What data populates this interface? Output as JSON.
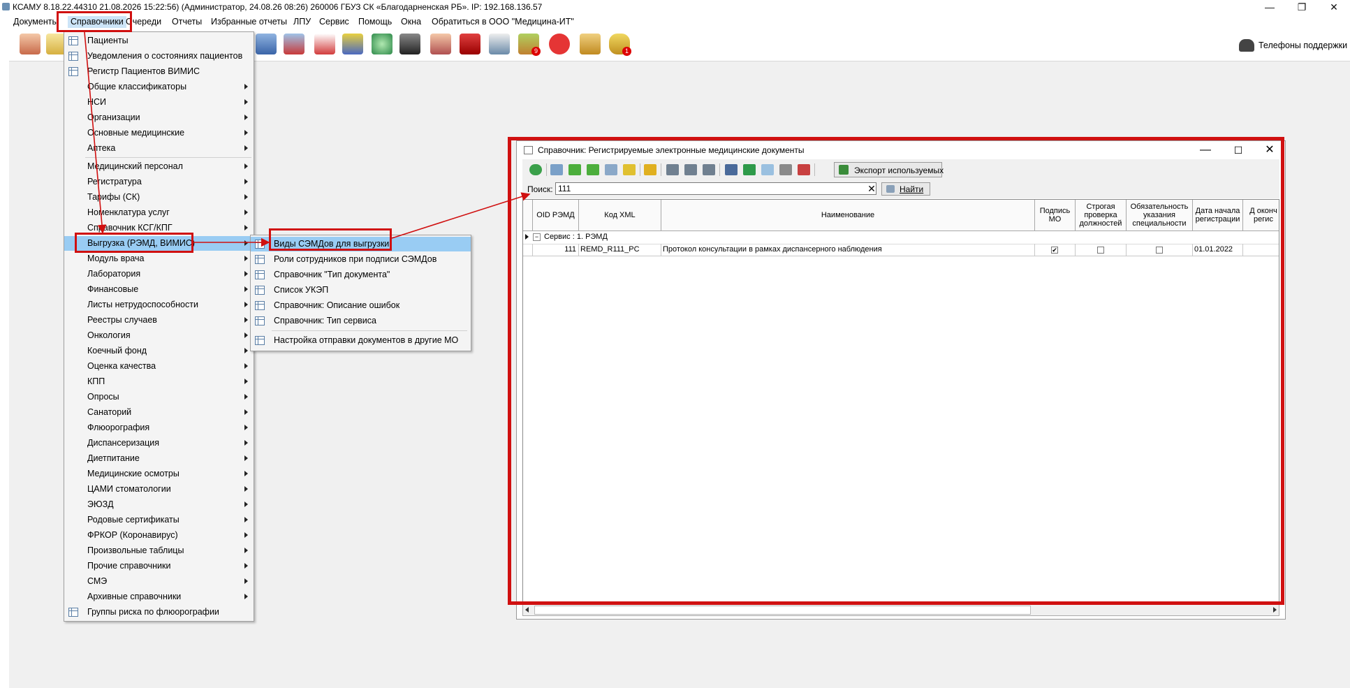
{
  "app": {
    "title": "КСАМУ 8.18.22.44310 21.08.2026 15:22:56) (Администратор, 24.08.26 08:26)  260006 ГБУЗ СК «Благодарненская РБ». IP: 192.168.136.57",
    "window_controls": {
      "minimize": "—",
      "maximize": "❐",
      "close": "✕"
    }
  },
  "menubar": [
    "Документы",
    "Справочники",
    "Очереди",
    "Отчеты",
    "Избранные отчеты",
    "ЛПУ",
    "Сервис",
    "Помощь",
    "Окна",
    "Обратиться в ООО \"Медицина-ИТ\""
  ],
  "support": {
    "label": "Телефоны поддержки",
    "icon": "phone-icon"
  },
  "toolbar_badges": {
    "badge1": "9",
    "badge2": "1"
  },
  "menu_main": {
    "items": [
      {
        "label": "Пациенты",
        "submenu": false,
        "icon": "patient-icon"
      },
      {
        "label": "Уведомления о состояниях пациентов",
        "submenu": false,
        "icon": "table-icon"
      },
      {
        "label": "Регистр Пациентов ВИМИС",
        "submenu": false,
        "icon": "grid-icon"
      },
      {
        "label": "Общие классификаторы",
        "submenu": true
      },
      {
        "label": "НСИ",
        "submenu": true
      },
      {
        "label": "Организации",
        "submenu": true
      },
      {
        "label": "Основные медицинские",
        "submenu": true
      },
      {
        "label": "Аптека",
        "submenu": true
      },
      {
        "label": "Медицинский персонал",
        "submenu": true
      },
      {
        "label": "Регистратура",
        "submenu": true
      },
      {
        "label": "Тарифы (СК)",
        "submenu": true
      },
      {
        "label": "Номенклатура услуг",
        "submenu": true
      },
      {
        "label": "Справочник КСГ/КПГ",
        "submenu": true
      },
      {
        "label": "Выгрузка (РЭМД, ВИМИС)",
        "submenu": true,
        "highlighted": true
      },
      {
        "label": "Модуль врача",
        "submenu": true
      },
      {
        "label": "Лаборатория",
        "submenu": true
      },
      {
        "label": "Финансовые",
        "submenu": true
      },
      {
        "label": "Листы нетрудоспособности",
        "submenu": true
      },
      {
        "label": "Реестры случаев",
        "submenu": true
      },
      {
        "label": "Онкология",
        "submenu": true
      },
      {
        "label": "Коечный фонд",
        "submenu": true
      },
      {
        "label": "Оценка качества",
        "submenu": true
      },
      {
        "label": "КПП",
        "submenu": true
      },
      {
        "label": "Опросы",
        "submenu": true
      },
      {
        "label": "Санаторий",
        "submenu": true
      },
      {
        "label": "Флюорография",
        "submenu": true
      },
      {
        "label": "Диспансеризация",
        "submenu": true
      },
      {
        "label": "Диетпитание",
        "submenu": true
      },
      {
        "label": "Медицинские осмотры",
        "submenu": true
      },
      {
        "label": "ЦАМИ стоматологии",
        "submenu": true
      },
      {
        "label": "ЭЮЗД",
        "submenu": true
      },
      {
        "label": "Родовые сертификаты",
        "submenu": true
      },
      {
        "label": "ФРКОР (Коронавирус)",
        "submenu": true
      },
      {
        "label": "Произвольные таблицы",
        "submenu": true
      },
      {
        "label": "Прочие справочники",
        "submenu": true
      },
      {
        "label": "СМЭ",
        "submenu": true
      },
      {
        "label": "Архивные справочники",
        "submenu": true
      },
      {
        "label": "Группы риска по флюорографии",
        "submenu": false,
        "icon": "table-icon"
      }
    ]
  },
  "menu_sub": {
    "items": [
      {
        "label": "Виды СЭМДов для выгрузки",
        "highlighted": true
      },
      {
        "label": "Роли сотрудников при подписи СЭМДов"
      },
      {
        "label": "Справочник \"Тип документа\""
      },
      {
        "label": "Список УКЭП"
      },
      {
        "label": "Справочник: Описание ошибок"
      },
      {
        "label": "Справочник: Тип сервиса"
      },
      {
        "label": "Настройка отправки документов в другие МО"
      }
    ]
  },
  "dialog": {
    "title": "Справочник: Регистрируемые электронные медицинские документы",
    "export_button": "Экспорт используемых",
    "search_label": "Поиск:",
    "search_value": "111",
    "find_button": "Найти",
    "columns": [
      "OID РЭМД",
      "Код XML",
      "Наименование",
      "Подпись МО",
      "Строгая проверка должностей",
      "Обязательность указания специальности",
      "Дата начала регистрации",
      "Д оконч регис"
    ],
    "group_label": "Сервис : 1. РЭМД",
    "rows": [
      {
        "oid": "111",
        "code": "REMD_R111_PC",
        "name": "Протокол консультации в рамках диспансерного наблюдения",
        "sign_mo": true,
        "strict_check": false,
        "spec_required": false,
        "date_start": "01.01.2022"
      }
    ]
  }
}
